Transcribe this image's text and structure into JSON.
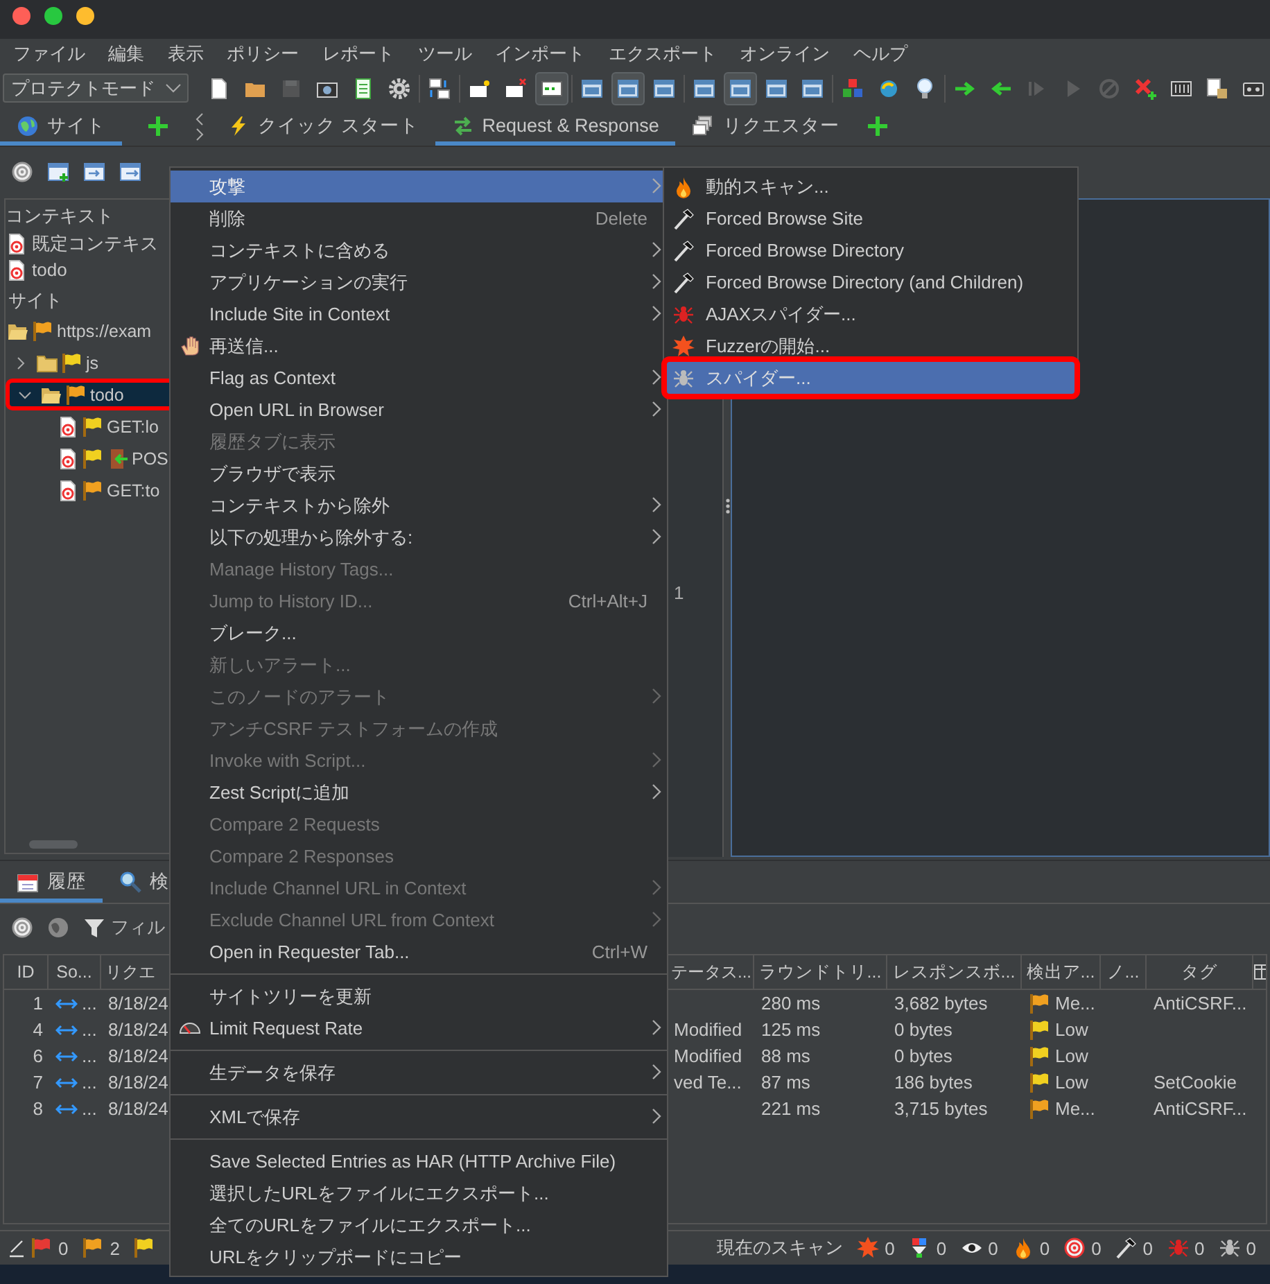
{
  "window": {
    "buttons": [
      {
        "color": "#fe5f57"
      },
      {
        "color": "#28c840"
      },
      {
        "color": "#febc2e"
      }
    ]
  },
  "menu_bar": [
    "ファイル",
    "編集",
    "表示",
    "ポリシー",
    "レポート",
    "ツール",
    "インポート",
    "エクスポート",
    "オンライン",
    "ヘルプ"
  ],
  "toolbar": {
    "mode": "プロテクトモード",
    "buttons": [
      {
        "kind": "document",
        "pressed": false,
        "disabled": false
      },
      {
        "kind": "folder",
        "pressed": false,
        "disabled": false
      },
      {
        "kind": "disk",
        "pressed": false,
        "disabled": true
      },
      {
        "kind": "camera",
        "pressed": false,
        "disabled": false
      },
      {
        "kind": "sheet",
        "pressed": false,
        "disabled": false
      },
      {
        "kind": "gear",
        "pressed": false,
        "disabled": false
      },
      {
        "kind": "separator"
      },
      {
        "kind": "swap",
        "pressed": false,
        "disabled": false
      },
      {
        "kind": "separator"
      },
      {
        "kind": "note",
        "pressed": false,
        "disabled": false
      },
      {
        "kind": "note-remove",
        "pressed": false,
        "disabled": false
      },
      {
        "kind": "terminal",
        "pressed": true,
        "disabled": false
      },
      {
        "kind": "separator"
      },
      {
        "kind": "layout",
        "pressed": false,
        "disabled": false
      },
      {
        "kind": "layout",
        "pressed": true,
        "disabled": false
      },
      {
        "kind": "layout",
        "pressed": false,
        "disabled": false
      },
      {
        "kind": "separator"
      },
      {
        "kind": "layout",
        "pressed": false,
        "disabled": false
      },
      {
        "kind": "layout",
        "pressed": true,
        "disabled": false
      },
      {
        "kind": "layout",
        "pressed": false,
        "disabled": false
      },
      {
        "kind": "layout",
        "pressed": false,
        "disabled": false
      },
      {
        "kind": "separator"
      },
      {
        "kind": "blocks",
        "pressed": false,
        "disabled": false
      },
      {
        "kind": "refresh",
        "pressed": false,
        "disabled": false
      },
      {
        "kind": "bulb",
        "pressed": false,
        "disabled": false
      },
      {
        "kind": "separator"
      },
      {
        "kind": "arrow-right",
        "pressed": false,
        "disabled": false
      },
      {
        "kind": "arrow-left",
        "pressed": false,
        "disabled": false
      },
      {
        "kind": "step",
        "pressed": false,
        "disabled": true
      },
      {
        "kind": "play",
        "pressed": false,
        "disabled": true
      },
      {
        "kind": "stop",
        "pressed": false,
        "disabled": true
      },
      {
        "kind": "cross-plus",
        "pressed": false,
        "disabled": false
      },
      {
        "kind": "grid",
        "pressed": false,
        "disabled": false
      },
      {
        "kind": "lock-document",
        "pressed": false,
        "disabled": false
      },
      {
        "kind": "tape",
        "pressed": false,
        "disabled": false
      }
    ]
  },
  "tab_groups": [
    {
      "tabs": [
        {
          "label": "サイト",
          "selected": true
        }
      ]
    },
    {
      "tabs": [
        {
          "label": "クイック スタート",
          "selected": false
        },
        {
          "label": "Request & Response",
          "selected": true
        },
        {
          "label": "リクエスター",
          "selected": false
        }
      ]
    }
  ],
  "sites": {
    "contexts_heading": "コンテキスト",
    "contexts": [
      "既定コンテキス",
      "todo"
    ],
    "sites_heading": "サイト",
    "tree": [
      {
        "label": "https://exam",
        "kind": "folder",
        "color": "#f0a020",
        "selected": false,
        "annotated": false,
        "children": [
          {
            "label": "js",
            "kind": "folder",
            "expanded": false,
            "color": "#f0d020",
            "selected": false,
            "annotated": false
          },
          {
            "label": "todo",
            "kind": "folder",
            "expanded": true,
            "color": "#f0a020",
            "selected": true,
            "annotated": true,
            "children": [
              {
                "label": "GET:lo",
                "kind": "request",
                "color": "#f0d020",
                "selected": false,
                "annotated": false
              },
              {
                "label": "POS",
                "kind": "login",
                "color": "#f0d020",
                "selected": false,
                "annotated": false
              },
              {
                "label": "GET:to",
                "kind": "request",
                "color": "#f0a020",
                "selected": false,
                "annotated": false
              }
            ]
          }
        ]
      }
    ]
  },
  "response_editor": {
    "line_number": "1"
  },
  "history": {
    "tabs": [
      {
        "label": "履歴",
        "selected": true
      },
      {
        "label": "検",
        "selected": false
      }
    ],
    "filter_label": "フィル",
    "columns_left": [
      "ID",
      "So...",
      "リクエ"
    ],
    "columns_right": [
      "テータス...",
      "ラウンドトリ...",
      "レスポンスボ...",
      "検出ア...",
      "ノ...",
      "タグ"
    ],
    "rows": [
      {
        "id": "1",
        "source": "...",
        "time": "8/18/24",
        "rtt": "280 ms",
        "size": "3,682 bytes",
        "alert": "Me...",
        "color": "#f0a020",
        "tag": "AntiCSRF..."
      },
      {
        "id": "4",
        "source": "...",
        "time": "8/18/24",
        "status": "Modified",
        "rtt": "125 ms",
        "size": "0 bytes",
        "alert": "Low",
        "color": "#f0d020"
      },
      {
        "id": "6",
        "source": "...",
        "time": "8/18/24",
        "status": "Modified",
        "rtt": "88 ms",
        "size": "0 bytes",
        "alert": "Low",
        "color": "#f0d020"
      },
      {
        "id": "7",
        "source": "...",
        "time": "8/18/24",
        "status": "ved Te...",
        "rtt": "87 ms",
        "size": "186 bytes",
        "alert": "Low",
        "color": "#f0d020",
        "tag": "SetCookie"
      },
      {
        "id": "8",
        "source": "...",
        "time": "8/18/24",
        "rtt": "221 ms",
        "size": "3,715 bytes",
        "alert": "Me...",
        "color": "#f0a020",
        "tag": "AntiCSRF..."
      }
    ]
  },
  "status_bar": {
    "alerts": [
      {
        "color": "#e53935",
        "count": "0"
      },
      {
        "color": "#f0a020",
        "count": "2"
      },
      {
        "color": "#f0d020"
      }
    ],
    "scan_label": "現在のスキャン",
    "scans": [
      "0",
      "0",
      "0",
      "0",
      "0",
      "0",
      "0",
      "0"
    ]
  },
  "context_menu": {
    "items": [
      {
        "kind": "item",
        "label": "攻撃",
        "submenu": true,
        "disabled": false,
        "selected": true
      },
      {
        "kind": "item",
        "label": "削除",
        "shortcut": "Delete",
        "submenu": false,
        "disabled": false,
        "selected": false
      },
      {
        "kind": "item",
        "label": "コンテキストに含める",
        "submenu": true,
        "disabled": false,
        "selected": false
      },
      {
        "kind": "item",
        "label": "アプリケーションの実行",
        "submenu": true,
        "disabled": false,
        "selected": false
      },
      {
        "kind": "item",
        "label": "Include Site in Context",
        "submenu": true,
        "disabled": false,
        "selected": false
      },
      {
        "kind": "item",
        "label": "再送信...",
        "submenu": false,
        "disabled": false,
        "selected": false
      },
      {
        "kind": "item",
        "label": "Flag as Context",
        "submenu": true,
        "disabled": false,
        "selected": false
      },
      {
        "kind": "item",
        "label": "Open URL in Browser",
        "submenu": true,
        "disabled": false,
        "selected": false
      },
      {
        "kind": "item",
        "label": "履歴タブに表示",
        "submenu": false,
        "disabled": true,
        "selected": false
      },
      {
        "kind": "item",
        "label": "ブラウザで表示",
        "submenu": false,
        "disabled": false,
        "selected": false
      },
      {
        "kind": "item",
        "label": "コンテキストから除外",
        "submenu": true,
        "disabled": false,
        "selected": false
      },
      {
        "kind": "item",
        "label": "以下の処理から除外する:",
        "submenu": true,
        "disabled": false,
        "selected": false
      },
      {
        "kind": "item",
        "label": "Manage History Tags...",
        "submenu": false,
        "disabled": true,
        "selected": false
      },
      {
        "kind": "item",
        "label": "Jump to History ID...",
        "shortcut": "Ctrl+Alt+J",
        "submenu": false,
        "disabled": true,
        "selected": false
      },
      {
        "kind": "item",
        "label": "ブレーク...",
        "submenu": false,
        "disabled": false,
        "selected": false
      },
      {
        "kind": "item",
        "label": "新しいアラート...",
        "submenu": false,
        "disabled": true,
        "selected": false
      },
      {
        "kind": "item",
        "label": "このノードのアラート",
        "submenu": true,
        "disabled": true,
        "selected": false
      },
      {
        "kind": "item",
        "label": "アンチCSRF テストフォームの作成",
        "submenu": false,
        "disabled": true,
        "selected": false
      },
      {
        "kind": "item",
        "label": "Invoke with Script...",
        "submenu": true,
        "disabled": true,
        "selected": false
      },
      {
        "kind": "item",
        "label": "Zest Scriptに追加",
        "submenu": true,
        "disabled": false,
        "selected": false
      },
      {
        "kind": "item",
        "label": "Compare 2 Requests",
        "submenu": false,
        "disabled": true,
        "selected": false
      },
      {
        "kind": "item",
        "label": "Compare 2 Responses",
        "submenu": false,
        "disabled": true,
        "selected": false
      },
      {
        "kind": "item",
        "label": "Include Channel URL in Context",
        "submenu": true,
        "disabled": true,
        "selected": false
      },
      {
        "kind": "item",
        "label": "Exclude Channel URL from Context",
        "submenu": true,
        "disabled": true,
        "selected": false
      },
      {
        "kind": "item",
        "label": "Open in Requester Tab...",
        "shortcut": "Ctrl+W",
        "submenu": false,
        "disabled": false,
        "selected": false
      },
      {
        "kind": "separator"
      },
      {
        "kind": "item",
        "label": "サイトツリーを更新",
        "submenu": false,
        "disabled": false,
        "selected": false
      },
      {
        "kind": "item",
        "label": "Limit Request Rate",
        "submenu": true,
        "disabled": false,
        "selected": false
      },
      {
        "kind": "separator"
      },
      {
        "kind": "item",
        "label": "生データを保存",
        "submenu": true,
        "disabled": false,
        "selected": false
      },
      {
        "kind": "separator"
      },
      {
        "kind": "item",
        "label": "XMLで保存",
        "submenu": true,
        "disabled": false,
        "selected": false
      },
      {
        "kind": "separator"
      },
      {
        "kind": "item",
        "label": "Save Selected Entries as HAR (HTTP Archive File)",
        "submenu": false,
        "disabled": false,
        "selected": false
      },
      {
        "kind": "item",
        "label": "選択したURLをファイルにエクスポート...",
        "submenu": false,
        "disabled": false,
        "selected": false
      },
      {
        "kind": "item",
        "label": "全てのURLをファイルにエクスポート...",
        "submenu": false,
        "disabled": false,
        "selected": false
      },
      {
        "kind": "item",
        "label": "URLをクリップボードにコピー",
        "submenu": false,
        "disabled": false,
        "selected": false
      }
    ]
  },
  "attack_submenu": {
    "items": [
      {
        "label": "動的スキャン...",
        "selected": false,
        "annotated": false
      },
      {
        "label": "Forced Browse Site",
        "selected": false,
        "annotated": false
      },
      {
        "label": "Forced Browse Directory",
        "selected": false,
        "annotated": false
      },
      {
        "label": "Forced Browse Directory (and Children)",
        "selected": false,
        "annotated": false
      },
      {
        "label": "AJAXスパイダー...",
        "selected": false,
        "annotated": false
      },
      {
        "label": "Fuzzerの開始...",
        "selected": false,
        "annotated": false
      },
      {
        "label": "スパイダー...",
        "selected": true,
        "annotated": true
      }
    ]
  }
}
